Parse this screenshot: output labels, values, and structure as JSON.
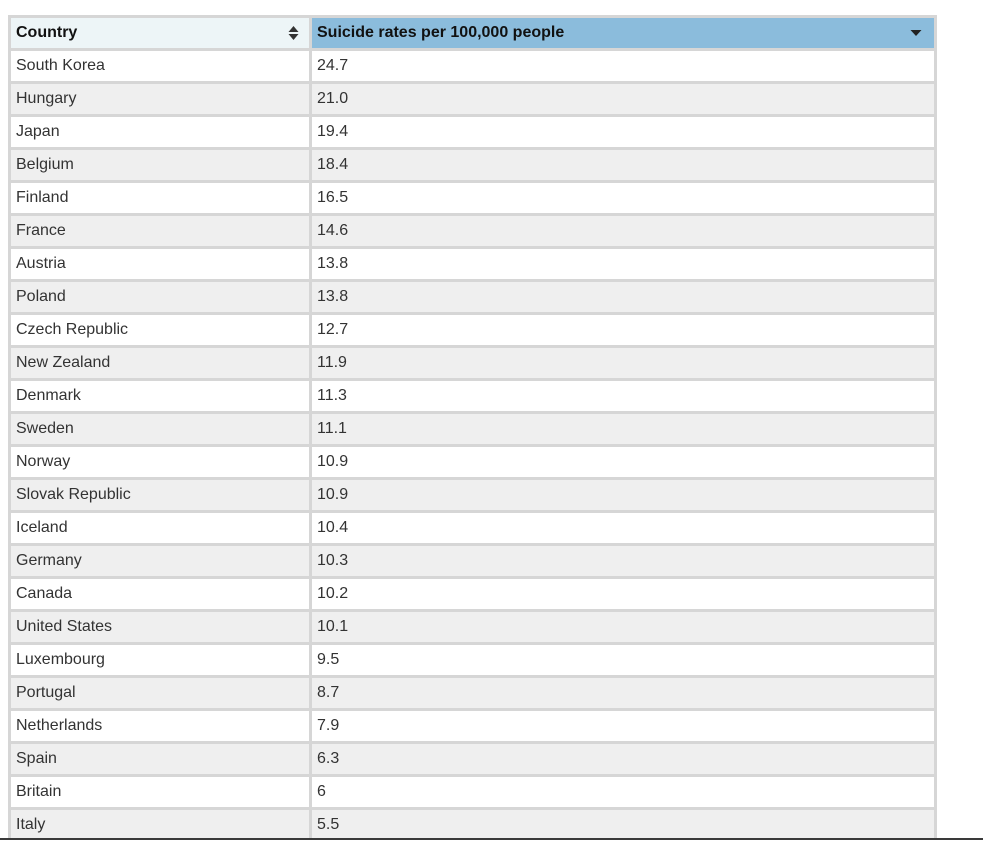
{
  "table": {
    "headers": {
      "country": "Country",
      "rate": "Suicide rates per 100,000 people"
    },
    "sort_column": "rate",
    "sort_direction": "descending",
    "rows": [
      {
        "country": "South Korea",
        "rate": "24.7"
      },
      {
        "country": "Hungary",
        "rate": "21.0"
      },
      {
        "country": "Japan",
        "rate": "19.4"
      },
      {
        "country": "Belgium",
        "rate": "18.4"
      },
      {
        "country": "Finland",
        "rate": "16.5"
      },
      {
        "country": "France",
        "rate": "14.6"
      },
      {
        "country": "Austria",
        "rate": "13.8"
      },
      {
        "country": "Poland",
        "rate": "13.8"
      },
      {
        "country": "Czech Republic",
        "rate": "12.7"
      },
      {
        "country": "New Zealand",
        "rate": "11.9"
      },
      {
        "country": "Denmark",
        "rate": "11.3"
      },
      {
        "country": "Sweden",
        "rate": "11.1"
      },
      {
        "country": "Norway",
        "rate": "10.9"
      },
      {
        "country": "Slovak Republic",
        "rate": "10.9"
      },
      {
        "country": "Iceland",
        "rate": "10.4"
      },
      {
        "country": "Germany",
        "rate": "10.3"
      },
      {
        "country": "Canada",
        "rate": "10.2"
      },
      {
        "country": "United States",
        "rate": "10.1"
      },
      {
        "country": "Luxembourg",
        "rate": "9.5"
      },
      {
        "country": "Portugal",
        "rate": "8.7"
      },
      {
        "country": "Netherlands",
        "rate": "7.9"
      },
      {
        "country": "Spain",
        "rate": "6.3"
      },
      {
        "country": "Britain",
        "rate": "6"
      },
      {
        "country": "Italy",
        "rate": "5.5"
      }
    ]
  },
  "colors": {
    "active_header": "#8bbcdc",
    "inactive_header": "#edf5f7",
    "row_even": "#efefef",
    "row_odd": "#ffffff",
    "grid": "#d6d6d6"
  },
  "icons": {
    "country_sort": "sort-both-icon",
    "rate_sort": "sort-descending-icon"
  }
}
